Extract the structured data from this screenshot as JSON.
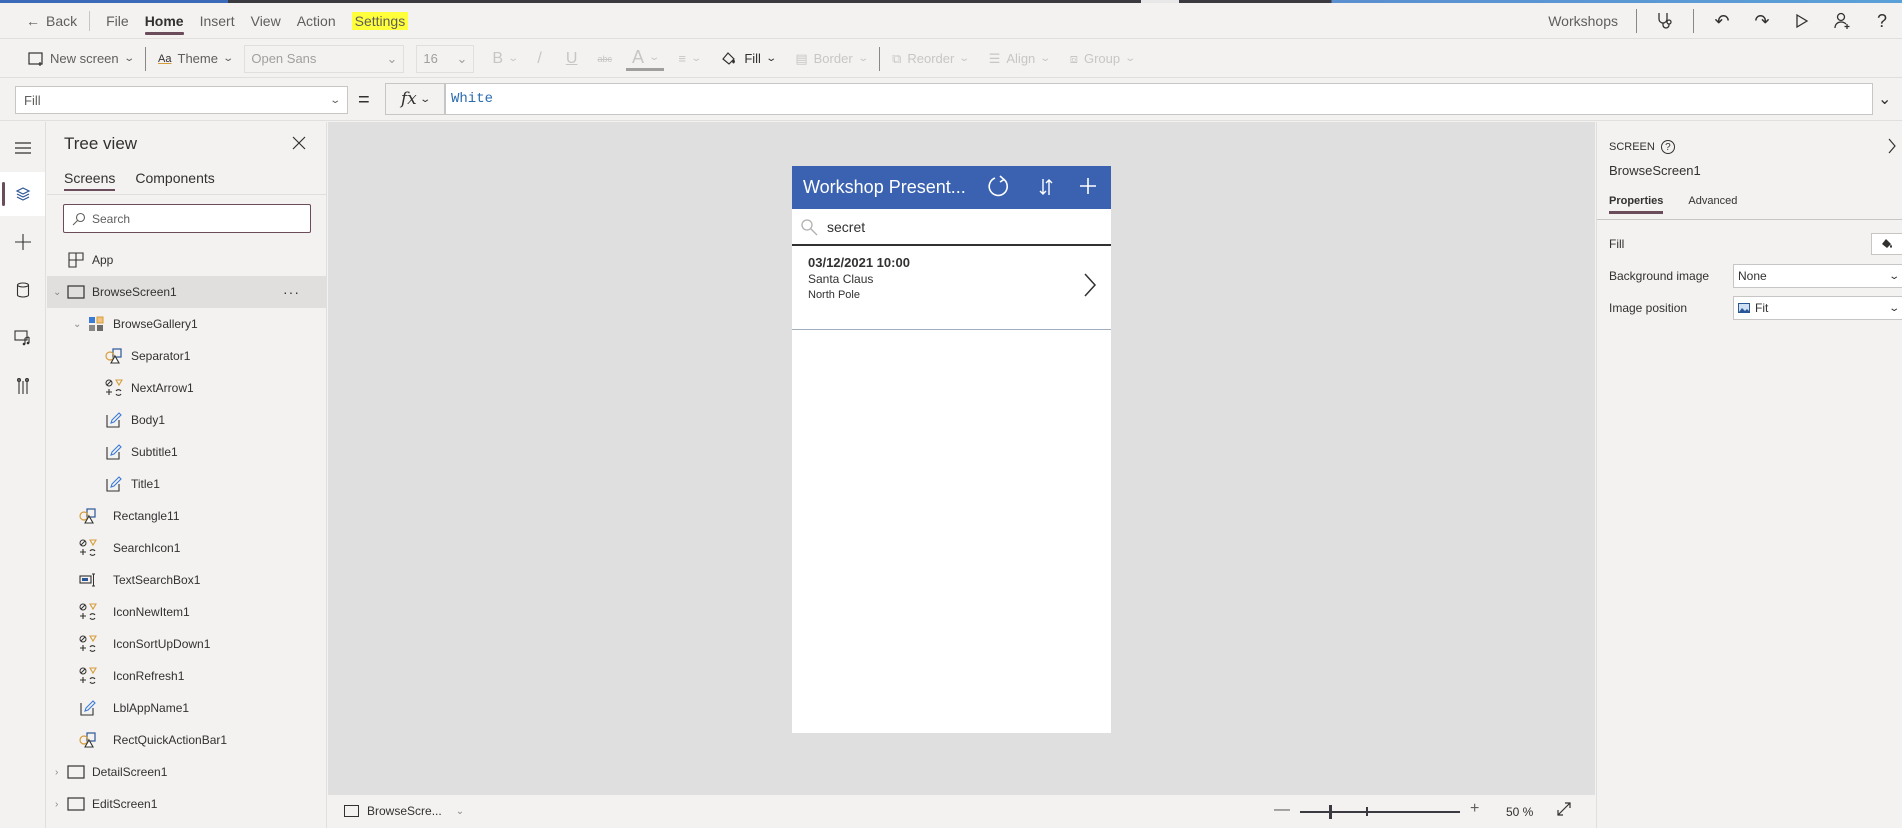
{
  "menubar": {
    "back_label": "Back",
    "items": [
      {
        "label": "File",
        "active": false
      },
      {
        "label": "Home",
        "active": true
      },
      {
        "label": "Insert",
        "active": false
      },
      {
        "label": "View",
        "active": false
      },
      {
        "label": "Action",
        "active": false
      },
      {
        "label": "Settings",
        "active": false,
        "highlighted": true
      }
    ],
    "app_name": "Workshops",
    "icons": [
      "app-checker-stethoscope-icon",
      "undo-icon",
      "redo-icon",
      "play-preview-icon",
      "share-user-icon",
      "help-icon"
    ]
  },
  "ribbon": {
    "new_screen": "New screen",
    "theme": "Theme",
    "font_family": "Open Sans",
    "font_size": "16",
    "bold": "B",
    "italic": "/",
    "underline": "U",
    "strikethrough": "abc",
    "font_color": "A",
    "fill": "Fill",
    "border": "Border",
    "reorder": "Reorder",
    "align": "Align",
    "group": "Group"
  },
  "formulabar": {
    "property": "Fill",
    "equals": "=",
    "fx": "fx",
    "formula": "White"
  },
  "treeview": {
    "title": "Tree view",
    "tabs": [
      {
        "label": "Screens",
        "active": true
      },
      {
        "label": "Components",
        "active": false
      }
    ],
    "search_placeholder": "Search",
    "items": [
      {
        "label": "App",
        "level": 0,
        "type": "app",
        "expander": "none"
      },
      {
        "label": "BrowseScreen1",
        "level": 0,
        "type": "screen",
        "expander": "expanded",
        "selected": true
      },
      {
        "label": "BrowseGallery1",
        "level": 1,
        "type": "gallery",
        "expander": "expanded"
      },
      {
        "label": "Separator1",
        "level": 2,
        "type": "shape",
        "expander": "none"
      },
      {
        "label": "NextArrow1",
        "level": 2,
        "type": "icon",
        "expander": "none"
      },
      {
        "label": "Body1",
        "level": 2,
        "type": "label",
        "expander": "none"
      },
      {
        "label": "Subtitle1",
        "level": 2,
        "type": "label",
        "expander": "none"
      },
      {
        "label": "Title1",
        "level": 2,
        "type": "label",
        "expander": "none"
      },
      {
        "label": "Rectangle11",
        "level": 1,
        "type": "shape",
        "expander": "none"
      },
      {
        "label": "SearchIcon1",
        "level": 1,
        "type": "icon",
        "expander": "none"
      },
      {
        "label": "TextSearchBox1",
        "level": 1,
        "type": "textinput",
        "expander": "none"
      },
      {
        "label": "IconNewItem1",
        "level": 1,
        "type": "icon",
        "expander": "none"
      },
      {
        "label": "IconSortUpDown1",
        "level": 1,
        "type": "icon",
        "expander": "none"
      },
      {
        "label": "IconRefresh1",
        "level": 1,
        "type": "icon",
        "expander": "none"
      },
      {
        "label": "LblAppName1",
        "level": 1,
        "type": "label",
        "expander": "none"
      },
      {
        "label": "RectQuickActionBar1",
        "level": 1,
        "type": "shape",
        "expander": "none"
      },
      {
        "label": "DetailScreen1",
        "level": 0,
        "type": "screen",
        "expander": "collapsed"
      },
      {
        "label": "EditScreen1",
        "level": 0,
        "type": "screen",
        "expander": "collapsed"
      }
    ]
  },
  "phone": {
    "header_title": "Workshop Present...",
    "header_color": "#3a62b0",
    "search_value": "secret",
    "gallery": [
      {
        "title": "03/12/2021 10:00",
        "subtitle": "Santa Claus",
        "body": "North Pole"
      }
    ]
  },
  "statusbar": {
    "screen_selector": "BrowseScre...",
    "zoom_percent": 50,
    "zoom_label": "50  %"
  },
  "properties": {
    "kind": "SCREEN",
    "name": "BrowseScreen1",
    "tabs": [
      {
        "label": "Properties",
        "active": true
      },
      {
        "label": "Advanced",
        "active": false
      }
    ],
    "rows": [
      {
        "label": "Fill",
        "control": "color-picker"
      },
      {
        "label": "Background image",
        "value": "None"
      },
      {
        "label": "Image position",
        "value": "Fit"
      }
    ]
  },
  "colors": {
    "accent": "#6b4c5a",
    "highlight": "#ffff3c",
    "formula_text": "#2b6cb0"
  }
}
